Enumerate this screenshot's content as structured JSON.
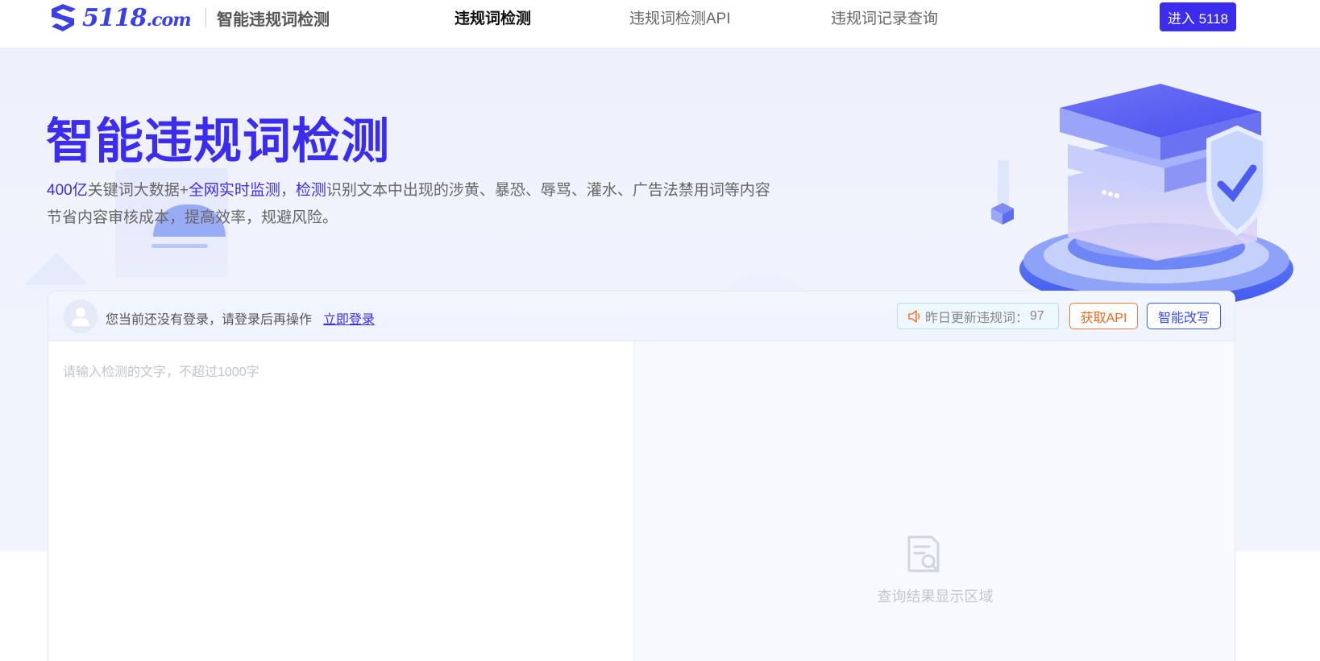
{
  "header": {
    "logo": {
      "text_main": "5118",
      "text_suffix": ".com"
    },
    "site_name": "智能违规词检测",
    "nav": [
      {
        "label": "违规词检测",
        "active": true
      },
      {
        "label": "违规词检测API",
        "active": false
      },
      {
        "label": "违规词记录查询",
        "active": false
      }
    ],
    "enter_button": "进入 5118"
  },
  "hero": {
    "title": "智能违规词检测",
    "line1": {
      "p1": "400亿",
      "p2": "关键词大数据+",
      "p3": "全网实时监测",
      "p4": "，",
      "p5": "检测",
      "p6": "识别文本中出现的涉黄、暴恐、辱骂、灌水、广告法禁用词等内容"
    },
    "line2": "节省内容审核成本，提高效率，规避风险。"
  },
  "panel": {
    "login_tip": "您当前还没有登录，请登录后再操作",
    "login_link": "立即登录",
    "update_label": "昨日更新违规词：",
    "update_count": "97",
    "api_button": "获取API",
    "rewrite_button": "智能改写",
    "input_placeholder": "请输入检测的文字，不超过1000字",
    "result_placeholder": "查询结果显示区域"
  },
  "colors": {
    "brand": "#3b2cf0",
    "api_orange": "#f0651f",
    "hero_bg": "#eef1fc"
  },
  "icons": [
    "logo-mark-icon",
    "avatar-user-icon",
    "speaker-icon",
    "document-search-icon"
  ]
}
